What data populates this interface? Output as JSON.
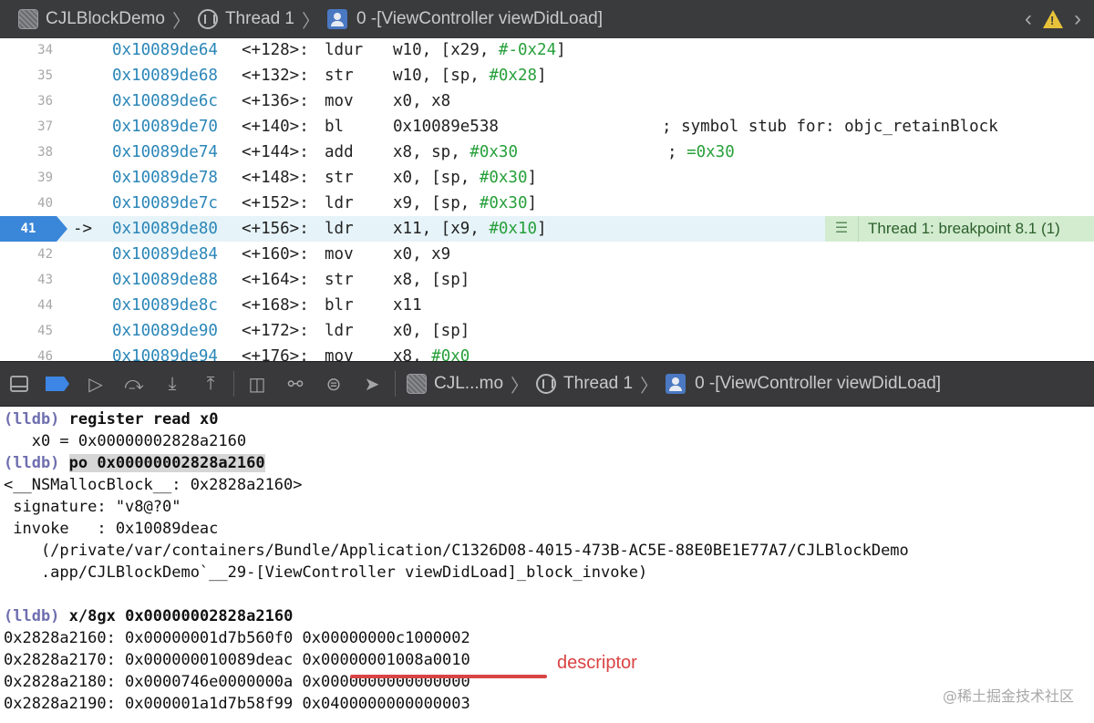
{
  "top_bar": {
    "project": "CJLBlockDemo",
    "thread": "Thread 1",
    "frame": "0 -[ViewController viewDidLoad]",
    "warning_glyph": "!"
  },
  "editor": {
    "lines": [
      {
        "num": "34",
        "addr": "0x10089de64",
        "off": "<+128>:",
        "mnem": "ldur",
        "ops": "w10, [x29, ",
        "imm": "#-0x24",
        "tail": "]",
        "comment": ""
      },
      {
        "num": "35",
        "addr": "0x10089de68",
        "off": "<+132>:",
        "mnem": "str",
        "ops": "w10, [sp, ",
        "imm": "#0x28",
        "tail": "]",
        "comment": ""
      },
      {
        "num": "36",
        "addr": "0x10089de6c",
        "off": "<+136>:",
        "mnem": "mov",
        "ops": "x0, x8",
        "imm": "",
        "tail": "",
        "comment": ""
      },
      {
        "num": "37",
        "addr": "0x10089de70",
        "off": "<+140>:",
        "mnem": "bl",
        "ops": "0x10089e538",
        "imm": "",
        "tail": "",
        "comment": "; symbol stub for: objc_retainBlock"
      },
      {
        "num": "38",
        "addr": "0x10089de74",
        "off": "<+144>:",
        "mnem": "add",
        "ops": "x8, sp, ",
        "imm": "#0x30",
        "tail": "",
        "comment": "; =0x30"
      },
      {
        "num": "39",
        "addr": "0x10089de78",
        "off": "<+148>:",
        "mnem": "str",
        "ops": "x0, [sp, ",
        "imm": "#0x30",
        "tail": "]",
        "comment": ""
      },
      {
        "num": "40",
        "addr": "0x10089de7c",
        "off": "<+152>:",
        "mnem": "ldr",
        "ops": "x9, [sp, ",
        "imm": "#0x30",
        "tail": "]",
        "comment": ""
      },
      {
        "num": "41",
        "addr": "0x10089de80",
        "off": "<+156>:",
        "mnem": "ldr",
        "ops": "x11, [x9, ",
        "imm": "#0x10",
        "tail": "]",
        "comment": ""
      },
      {
        "num": "42",
        "addr": "0x10089de84",
        "off": "<+160>:",
        "mnem": "mov",
        "ops": "x0, x9",
        "imm": "",
        "tail": "",
        "comment": ""
      },
      {
        "num": "43",
        "addr": "0x10089de88",
        "off": "<+164>:",
        "mnem": "str",
        "ops": "x8, [sp]",
        "imm": "",
        "tail": "",
        "comment": ""
      },
      {
        "num": "44",
        "addr": "0x10089de8c",
        "off": "<+168>:",
        "mnem": "blr",
        "ops": "x11",
        "imm": "",
        "tail": "",
        "comment": ""
      },
      {
        "num": "45",
        "addr": "0x10089de90",
        "off": "<+172>:",
        "mnem": "ldr",
        "ops": "x0, [sp]",
        "imm": "",
        "tail": "",
        "comment": ""
      },
      {
        "num": "46",
        "addr": "0x10089de94",
        "off": "<+176>:",
        "mnem": "mov",
        "ops": "x8, ",
        "imm": "#0x0",
        "tail": "",
        "comment": ""
      }
    ],
    "current_arrow": "->",
    "breakpoint_label": "Thread 1: breakpoint 8.1 (1)"
  },
  "debug_bar": {
    "project_short": "CJL...mo",
    "thread": "Thread 1",
    "frame": "0 -[ViewController viewDidLoad]"
  },
  "console": {
    "prompt": "(lldb)",
    "cmd1": "register read x0",
    "out1": "   x0 = 0x00000002828a2160",
    "cmd2": "po 0x00000002828a2160",
    "out2": [
      "<__NSMallocBlock__: 0x2828a2160>",
      " signature: \"v8@?0\"",
      " invoke   : 0x10089deac",
      "    (/private/var/containers/Bundle/Application/C1326D08-4015-473B-AC5E-88E0BE1E77A7/CJLBlockDemo",
      "    .app/CJLBlockDemo`__29-[ViewController viewDidLoad]_block_invoke)"
    ],
    "cmd3": "x/8gx 0x00000002828a2160",
    "memory": [
      "0x2828a2160: 0x00000001d7b560f0 0x00000000c1000002",
      "0x2828a2170: 0x000000010089deac 0x00000001008a0010",
      "0x2828a2180: 0x0000746e0000000a 0x0000000000000000",
      "0x2828a2190: 0x000001a1d7b58f99 0x0400000000000003"
    ],
    "annotation": "descriptor",
    "annotation_color": "#d94343"
  },
  "watermark": "@稀土掘金技术社区"
}
